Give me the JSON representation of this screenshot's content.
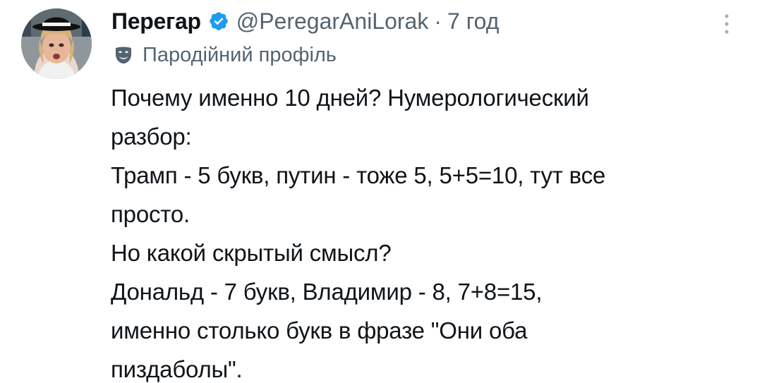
{
  "author": {
    "display_name": "Перегар",
    "handle": "@PeregarAniLorak",
    "separator": "·",
    "time": "7 год",
    "verified_icon": "verified-badge-icon",
    "avatar": "avatar-photo"
  },
  "parody": {
    "icon": "theater-mask-icon",
    "label": "Пародійний профіль"
  },
  "menu": {
    "icon": "more-vertical-icon"
  },
  "tweet": {
    "lines": [
      "Почему именно 10 дней? Нумерологический",
      "разбор:",
      "Трамп - 5 букв, путин - тоже 5, 5+5=10, тут все",
      "просто.",
      "Но какой скрытый смысл?",
      "Дональд - 7 букв, Владимир - 8, 7+8=15,",
      "именно столько букв в фразе \"Они оба",
      "пиздаболы\"."
    ]
  },
  "colors": {
    "text": "#0f1419",
    "secondary": "#536471",
    "verified": "#1d9bf0",
    "background": "#ffffff"
  }
}
